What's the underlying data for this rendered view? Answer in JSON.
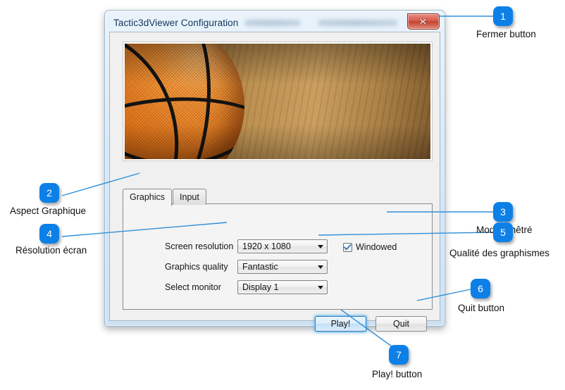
{
  "window": {
    "title": "Tactic3dViewer Configuration",
    "close_icon": "close-x-icon"
  },
  "banner": {
    "alt": "basketball-on-court-image"
  },
  "tabs": [
    {
      "label": "Graphics",
      "active": true
    },
    {
      "label": "Input",
      "active": false
    }
  ],
  "form": {
    "rows": [
      {
        "label": "Screen resolution",
        "value": "1920 x 1080"
      },
      {
        "label": "Graphics quality",
        "value": "Fantastic"
      },
      {
        "label": "Select monitor",
        "value": "Display 1"
      }
    ],
    "windowed": {
      "label": "Windowed",
      "checked": true
    }
  },
  "buttons": {
    "play": "Play!",
    "quit": "Quit"
  },
  "callouts": [
    {
      "number": "1",
      "label": "Fermer button"
    },
    {
      "number": "2",
      "label": "Aspect Graphique"
    },
    {
      "number": "3",
      "label": "Mode fenêtré"
    },
    {
      "number": "4",
      "label": "Résolution écran"
    },
    {
      "number": "5",
      "label": "Qualité des graphismes"
    },
    {
      "number": "6",
      "label": "Quit button"
    },
    {
      "number": "7",
      "label": "Play! button"
    }
  ],
  "colors": {
    "badge": "#0d80e8",
    "leader": "#2f8fd8",
    "close_button": "#c2442f",
    "page_background": "#ffffff"
  }
}
